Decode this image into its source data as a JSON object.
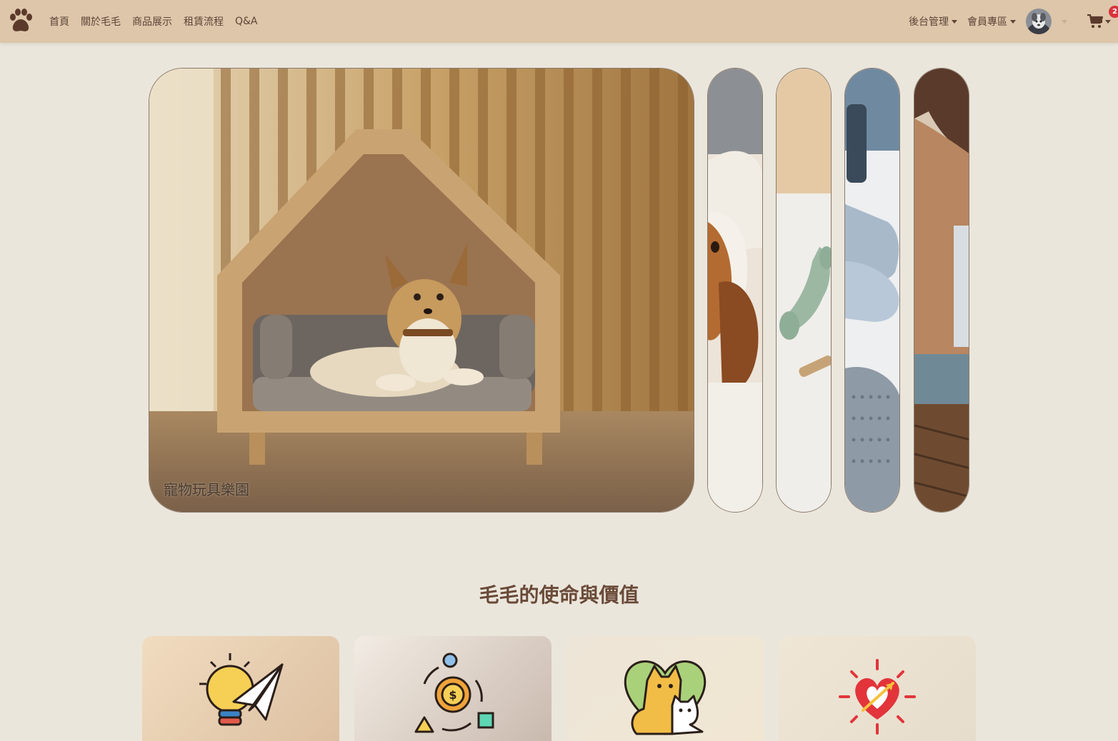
{
  "nav": {
    "links": [
      "首頁",
      "關於毛毛",
      "商品展示",
      "租賃流程",
      "Q&A"
    ],
    "admin_label": "後台管理",
    "member_label": "會員專區",
    "cart_count": "2"
  },
  "icons": {
    "logo": "paw-icon",
    "cart": "cart-icon"
  },
  "carousel": {
    "active_caption": "寵物玩具樂園",
    "slide_count": 5
  },
  "mission": {
    "title": "毛毛的使命與價值",
    "cards": [
      {
        "icon": "lightbulb-paper-plane-icon"
      },
      {
        "icon": "gear-cycle-icon"
      },
      {
        "icon": "dog-cat-heart-icon"
      },
      {
        "icon": "heart-arrow-icon"
      }
    ]
  },
  "colors": {
    "navbar": "#ddc6a9",
    "background": "#ebe6dc",
    "heading": "#6a4a38",
    "badge": "#d9343a"
  }
}
